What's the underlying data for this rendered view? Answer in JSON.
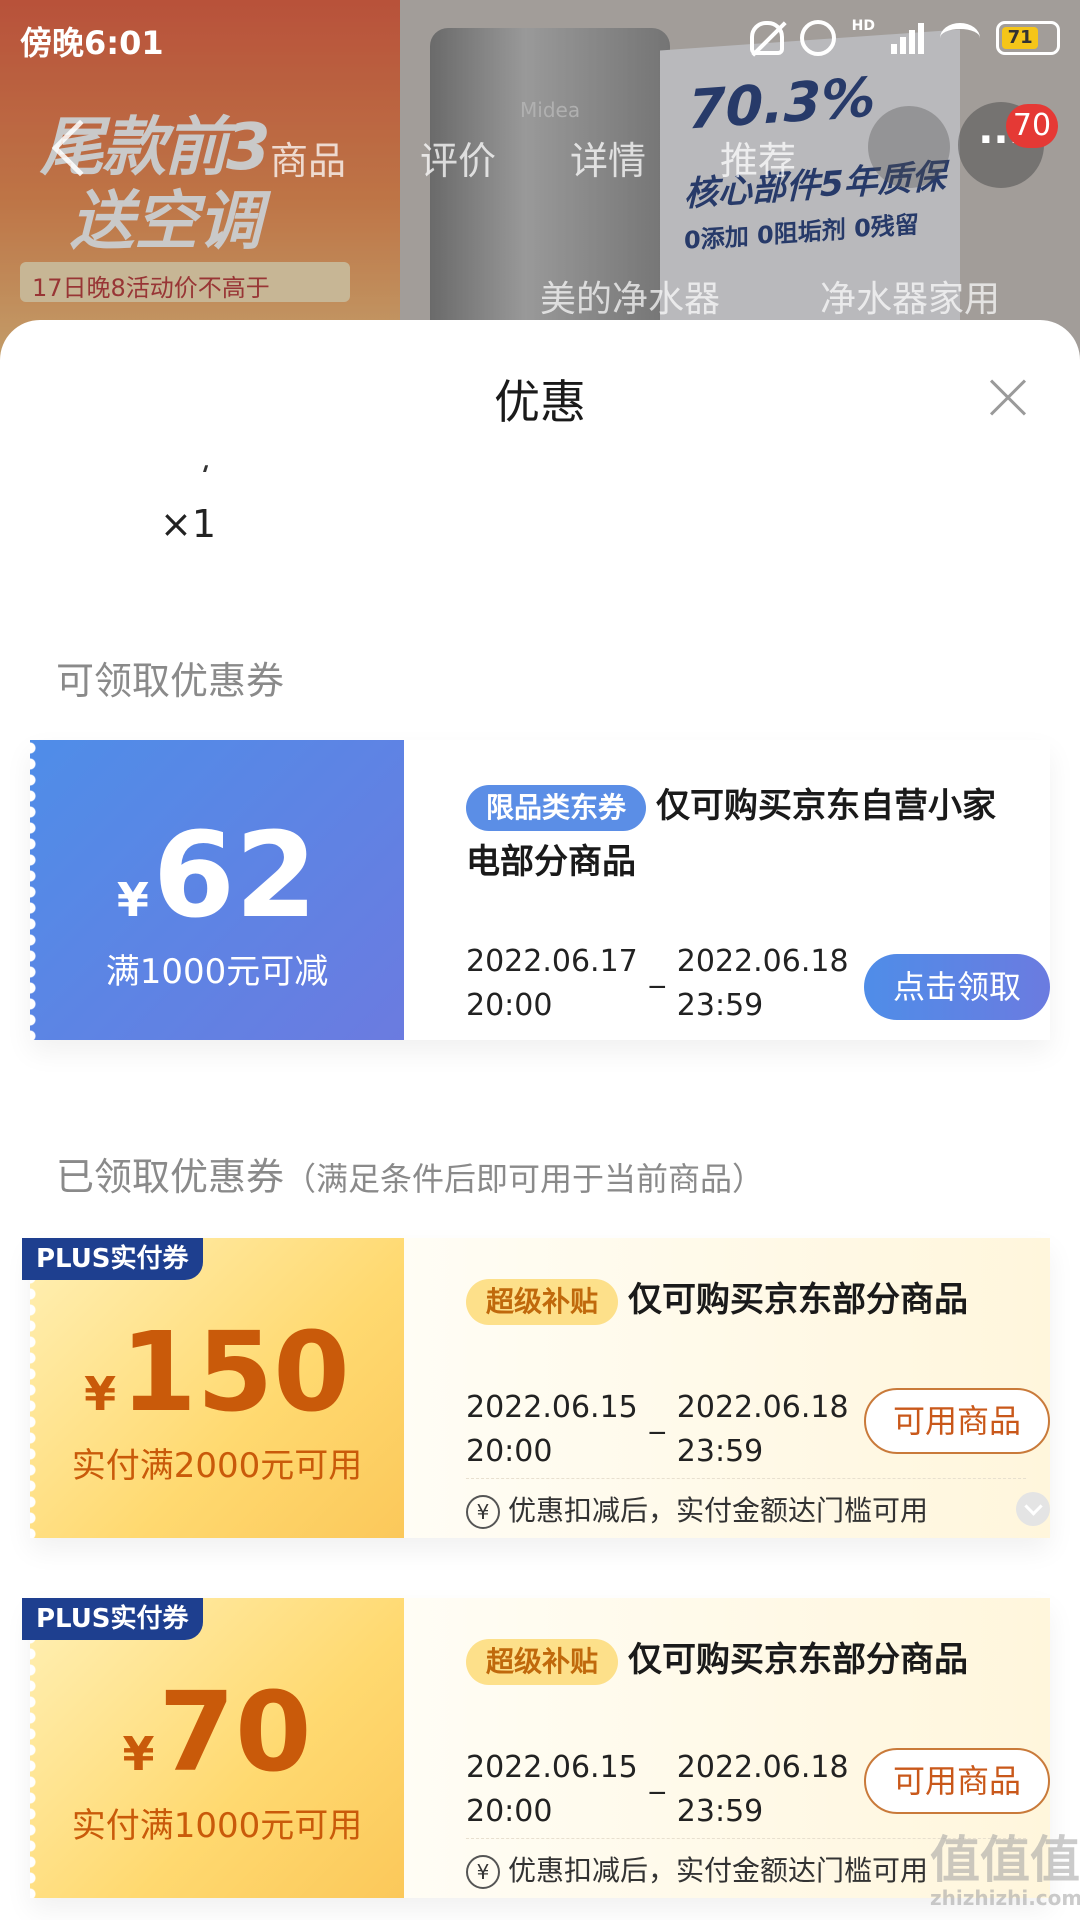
{
  "status_bar": {
    "time": "傍晚6:01",
    "hd": "HD",
    "battery": "71"
  },
  "background": {
    "banner_line1": "尾款前3",
    "banner_line2": "送空调",
    "banner_line3": "17日晚8活动价不高于",
    "tabs": [
      "商品",
      "评价",
      "详情",
      "推荐"
    ],
    "sub_tabs": [
      "美的净水器",
      "净水器家用"
    ],
    "product_logo": "Midea",
    "box_big": "70.3%",
    "box_line2": "核心部件5年质保",
    "box_line3": "0添加 0阻垢剂 0残留",
    "more_label": "···",
    "more_badge": "70"
  },
  "sheet": {
    "title": "优惠",
    "qty_cut": "一/",
    "qty": "×1",
    "claimable_title": "可领取优惠券",
    "claimed_title": "已领取优惠券",
    "claimed_note": "（满足条件后即可用于当前商品）"
  },
  "coupons_claimable": [
    {
      "symbol": "¥",
      "amount": "62",
      "condition": "满1000元可减",
      "tag": "限品类东券",
      "desc": "仅可购买京东自营小家电部分商品",
      "start_date": "2022.06.17",
      "start_time": "20:00",
      "end_date": "2022.06.18",
      "end_time": "23:59",
      "dash": "_",
      "button": "点击领取"
    }
  ],
  "coupons_claimed": [
    {
      "plus": "PLUS实付券",
      "symbol": "¥",
      "amount": "150",
      "condition": "实付满2000元可用",
      "tag": "超级补贴",
      "desc": "仅可购买京东部分商品",
      "start_date": "2022.06.15",
      "start_time": "20:00",
      "end_date": "2022.06.18",
      "end_time": "23:59",
      "dash": "_",
      "button": "可用商品",
      "tip_icon": "¥",
      "tip": "优惠扣减后，实付金额达门槛可用"
    },
    {
      "plus": "PLUS实付券",
      "symbol": "¥",
      "amount": "70",
      "condition": "实付满1000元可用",
      "tag": "超级补贴",
      "desc": "仅可购买京东部分商品",
      "start_date": "2022.06.15",
      "start_time": "20:00",
      "end_date": "2022.06.18",
      "end_time": "23:59",
      "dash": "_",
      "button": "可用商品",
      "tip_icon": "¥",
      "tip": "优惠扣减后，实付金额达门槛可用"
    }
  ],
  "watermark": {
    "main": "值值值",
    "sub": "zhizhizhi.com"
  }
}
